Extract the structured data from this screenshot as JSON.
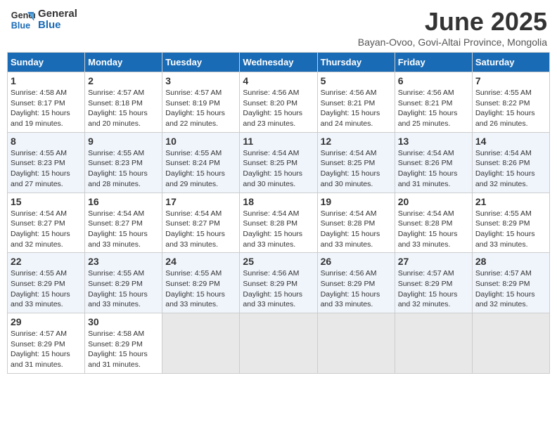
{
  "header": {
    "logo_line1": "General",
    "logo_line2": "Blue",
    "month_title": "June 2025",
    "subtitle": "Bayan-Ovoo, Govi-Altai Province, Mongolia"
  },
  "days_of_week": [
    "Sunday",
    "Monday",
    "Tuesday",
    "Wednesday",
    "Thursday",
    "Friday",
    "Saturday"
  ],
  "weeks": [
    [
      {
        "day": "1",
        "sunrise": "4:58 AM",
        "sunset": "8:17 PM",
        "daylight": "15 hours and 19 minutes."
      },
      {
        "day": "2",
        "sunrise": "4:57 AM",
        "sunset": "8:18 PM",
        "daylight": "15 hours and 20 minutes."
      },
      {
        "day": "3",
        "sunrise": "4:57 AM",
        "sunset": "8:19 PM",
        "daylight": "15 hours and 22 minutes."
      },
      {
        "day": "4",
        "sunrise": "4:56 AM",
        "sunset": "8:20 PM",
        "daylight": "15 hours and 23 minutes."
      },
      {
        "day": "5",
        "sunrise": "4:56 AM",
        "sunset": "8:21 PM",
        "daylight": "15 hours and 24 minutes."
      },
      {
        "day": "6",
        "sunrise": "4:56 AM",
        "sunset": "8:21 PM",
        "daylight": "15 hours and 25 minutes."
      },
      {
        "day": "7",
        "sunrise": "4:55 AM",
        "sunset": "8:22 PM",
        "daylight": "15 hours and 26 minutes."
      }
    ],
    [
      {
        "day": "8",
        "sunrise": "4:55 AM",
        "sunset": "8:23 PM",
        "daylight": "15 hours and 27 minutes."
      },
      {
        "day": "9",
        "sunrise": "4:55 AM",
        "sunset": "8:23 PM",
        "daylight": "15 hours and 28 minutes."
      },
      {
        "day": "10",
        "sunrise": "4:55 AM",
        "sunset": "8:24 PM",
        "daylight": "15 hours and 29 minutes."
      },
      {
        "day": "11",
        "sunrise": "4:54 AM",
        "sunset": "8:25 PM",
        "daylight": "15 hours and 30 minutes."
      },
      {
        "day": "12",
        "sunrise": "4:54 AM",
        "sunset": "8:25 PM",
        "daylight": "15 hours and 30 minutes."
      },
      {
        "day": "13",
        "sunrise": "4:54 AM",
        "sunset": "8:26 PM",
        "daylight": "15 hours and 31 minutes."
      },
      {
        "day": "14",
        "sunrise": "4:54 AM",
        "sunset": "8:26 PM",
        "daylight": "15 hours and 32 minutes."
      }
    ],
    [
      {
        "day": "15",
        "sunrise": "4:54 AM",
        "sunset": "8:27 PM",
        "daylight": "15 hours and 32 minutes."
      },
      {
        "day": "16",
        "sunrise": "4:54 AM",
        "sunset": "8:27 PM",
        "daylight": "15 hours and 33 minutes."
      },
      {
        "day": "17",
        "sunrise": "4:54 AM",
        "sunset": "8:27 PM",
        "daylight": "15 hours and 33 minutes."
      },
      {
        "day": "18",
        "sunrise": "4:54 AM",
        "sunset": "8:28 PM",
        "daylight": "15 hours and 33 minutes."
      },
      {
        "day": "19",
        "sunrise": "4:54 AM",
        "sunset": "8:28 PM",
        "daylight": "15 hours and 33 minutes."
      },
      {
        "day": "20",
        "sunrise": "4:54 AM",
        "sunset": "8:28 PM",
        "daylight": "15 hours and 33 minutes."
      },
      {
        "day": "21",
        "sunrise": "4:55 AM",
        "sunset": "8:29 PM",
        "daylight": "15 hours and 33 minutes."
      }
    ],
    [
      {
        "day": "22",
        "sunrise": "4:55 AM",
        "sunset": "8:29 PM",
        "daylight": "15 hours and 33 minutes."
      },
      {
        "day": "23",
        "sunrise": "4:55 AM",
        "sunset": "8:29 PM",
        "daylight": "15 hours and 33 minutes."
      },
      {
        "day": "24",
        "sunrise": "4:55 AM",
        "sunset": "8:29 PM",
        "daylight": "15 hours and 33 minutes."
      },
      {
        "day": "25",
        "sunrise": "4:56 AM",
        "sunset": "8:29 PM",
        "daylight": "15 hours and 33 minutes."
      },
      {
        "day": "26",
        "sunrise": "4:56 AM",
        "sunset": "8:29 PM",
        "daylight": "15 hours and 33 minutes."
      },
      {
        "day": "27",
        "sunrise": "4:57 AM",
        "sunset": "8:29 PM",
        "daylight": "15 hours and 32 minutes."
      },
      {
        "day": "28",
        "sunrise": "4:57 AM",
        "sunset": "8:29 PM",
        "daylight": "15 hours and 32 minutes."
      }
    ],
    [
      {
        "day": "29",
        "sunrise": "4:57 AM",
        "sunset": "8:29 PM",
        "daylight": "15 hours and 31 minutes."
      },
      {
        "day": "30",
        "sunrise": "4:58 AM",
        "sunset": "8:29 PM",
        "daylight": "15 hours and 31 minutes."
      },
      null,
      null,
      null,
      null,
      null
    ]
  ]
}
